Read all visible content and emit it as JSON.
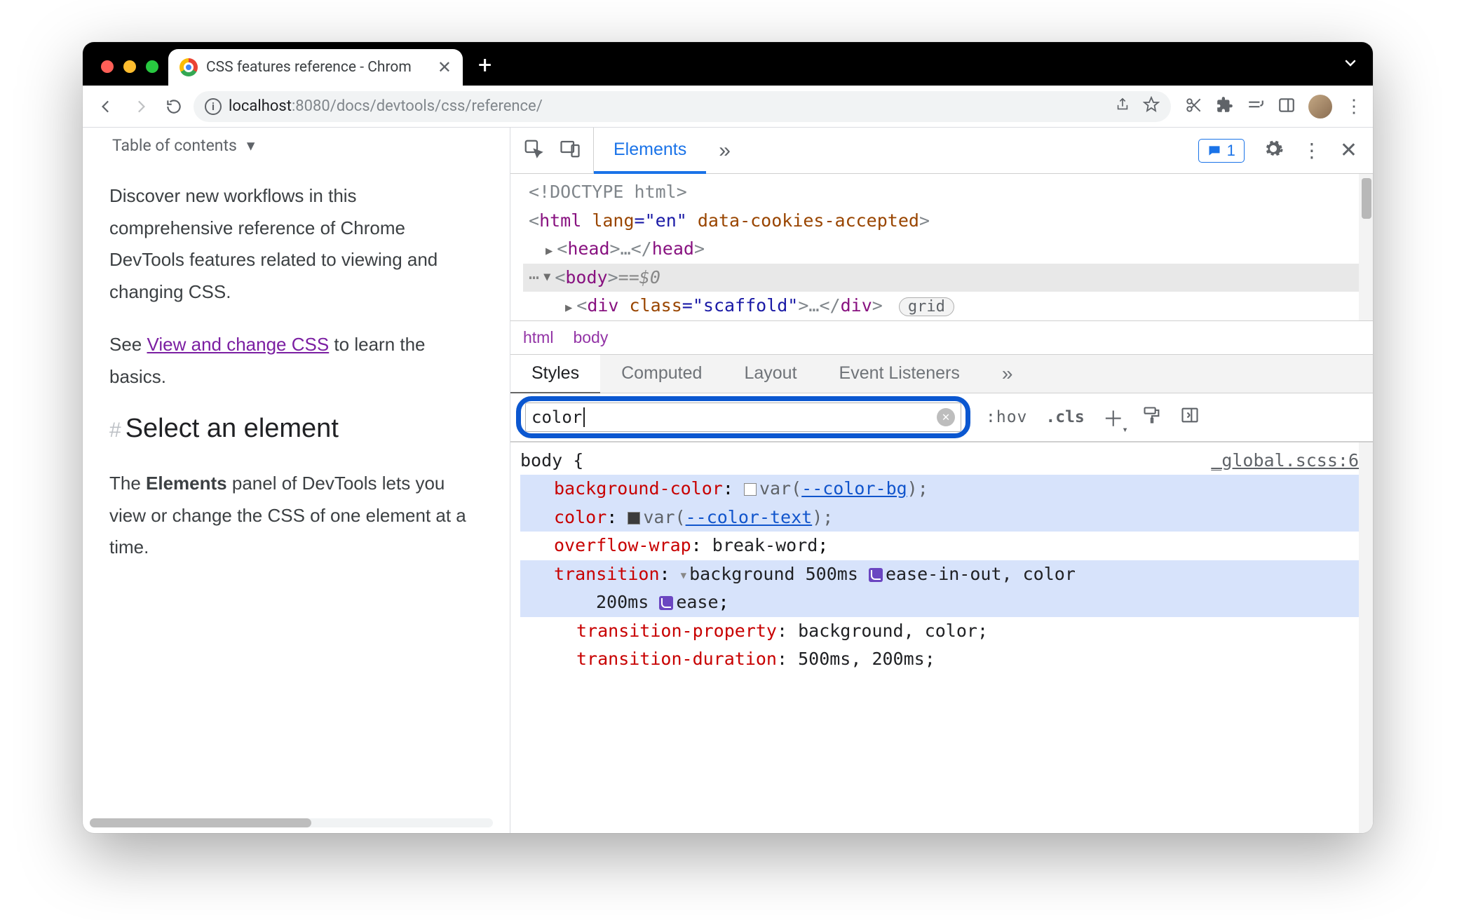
{
  "browser": {
    "tab_title": "CSS features reference - Chrom",
    "url_host": "localhost",
    "url_port": ":8080",
    "url_path": "/docs/devtools/css/reference/"
  },
  "page": {
    "toc_label": "Table of contents",
    "intro": "Discover new workflows in this comprehensive reference of Chrome DevTools features related to viewing and changing CSS.",
    "see_prefix": "See ",
    "see_link": "View and change CSS",
    "see_suffix": " to learn the basics.",
    "h2": "Select an element",
    "para2_a": "The ",
    "para2_b": "Elements",
    "para2_c": " panel of DevTools lets you view or change the CSS of one element at a time."
  },
  "devtools": {
    "tabs": {
      "elements": "Elements",
      "messages_count": "1"
    },
    "dom": {
      "doctype": "<!DOCTYPE html>",
      "html_open_a": "<",
      "html_open_b": "html",
      "html_lang_n": " lang",
      "html_lang_v": "=\"en\"",
      "html_attr2": " data-cookies-accepted",
      "html_close": ">",
      "head": "<head>…</head>",
      "body_open": "<body>",
      "body_eq": " == ",
      "body_d0": "$0",
      "div_open": "<div ",
      "div_classn": "class",
      "div_classv": "=\"scaffold\"",
      "div_rest": ">…</div>",
      "grid_badge": "grid",
      "crumb_html": "html",
      "crumb_body": "body"
    },
    "styles_tabs": {
      "styles": "Styles",
      "computed": "Computed",
      "layout": "Layout",
      "events": "Event Listeners"
    },
    "filter": {
      "value": "color",
      "hov": ":hov",
      "cls": ".cls"
    },
    "rule": {
      "selector": "body {",
      "source": "_global.scss:6",
      "d1_n": "background-color",
      "d1_v_var": "--color-bg",
      "d2_n": "color",
      "d2_v_var": "--color-text",
      "d3_n": "overflow-wrap",
      "d3_v": "break-word",
      "d4_n": "transition",
      "d4_v_a": "background 500ms ",
      "d4_v_b": "ease-in-out",
      "d4_v_c": ", color",
      "d4_line2_a": "200ms ",
      "d4_line2_b": "ease",
      "d5_n": "transition-property",
      "d5_v": "background, color",
      "d6_n": "transition-duration",
      "d6_v": "500ms, 200ms"
    }
  }
}
